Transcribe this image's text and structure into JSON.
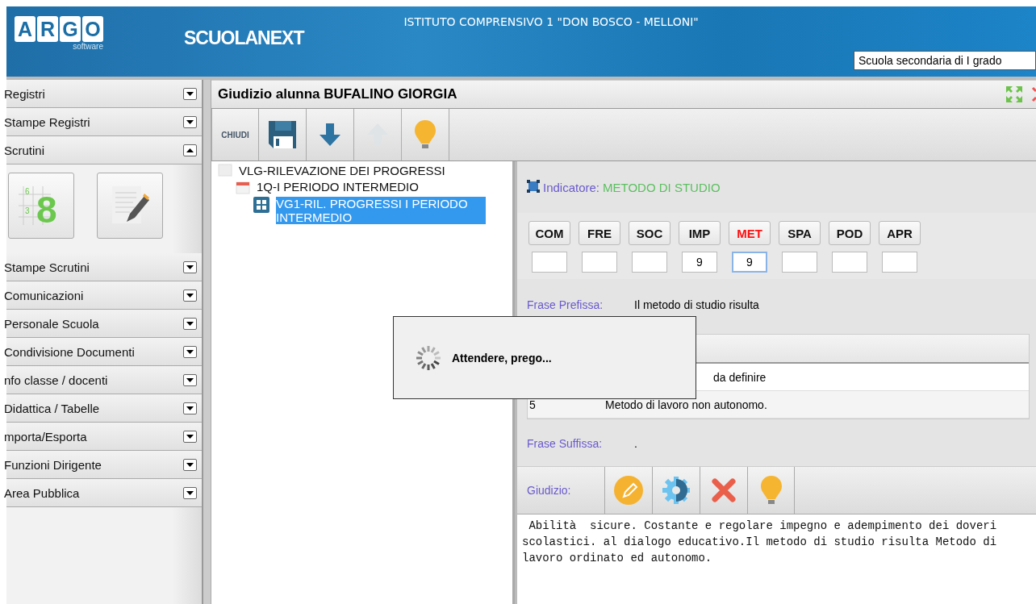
{
  "header": {
    "logo_letters": [
      "A",
      "R",
      "G",
      "O"
    ],
    "logo_sub": "software",
    "product": "SCUOLANEXT",
    "institute": "ISTITUTO COMPRENSIVO 1 \"DON BOSCO - MELLONI\"",
    "school_select": "Scuola secondaria di I grado"
  },
  "sidebar": {
    "items": [
      {
        "label": "Registri",
        "expanded": false
      },
      {
        "label": "Stampe Registri",
        "expanded": false
      },
      {
        "label": "Scrutini",
        "expanded": true
      },
      {
        "label": "Stampe Scrutini",
        "expanded": false
      },
      {
        "label": "Comunicazioni",
        "expanded": false
      },
      {
        "label": "Personale Scuola",
        "expanded": false
      },
      {
        "label": "Condivisione Documenti",
        "expanded": false
      },
      {
        "label": "nfo classe / docenti",
        "expanded": false
      },
      {
        "label": "Didattica / Tabelle",
        "expanded": false
      },
      {
        "label": "mporta/Esporta",
        "expanded": false
      },
      {
        "label": "Funzioni Dirigente",
        "expanded": false
      },
      {
        "label": "Area Pubblica",
        "expanded": false
      }
    ],
    "scrutini_icons": [
      {
        "kind": "grid",
        "labels": [
          "6",
          "3",
          "8"
        ]
      },
      {
        "kind": "pencil"
      }
    ]
  },
  "panel": {
    "title": "Giudizio alunna BUFALINO GIORGIA",
    "toolbar": [
      {
        "kind": "text",
        "label": "CHIUDI",
        "disabled": false
      },
      {
        "kind": "save",
        "disabled": false
      },
      {
        "kind": "down",
        "disabled": false
      },
      {
        "kind": "up",
        "disabled": true
      },
      {
        "kind": "bulb",
        "disabled": false
      }
    ],
    "tree": [
      {
        "label": "VLG-RILEVAZIONE DEI PROGRESSI",
        "selected": false,
        "children": [
          {
            "label": "1Q-I PERIODO INTERMEDIO",
            "selected": false,
            "children": [
              {
                "label": "VG1-RIL. PROGRESSI I PERIODO INTERMEDIO",
                "selected": true
              }
            ]
          }
        ]
      }
    ],
    "indicator": {
      "label": "Indicatore:",
      "value": "METODO DI STUDIO"
    },
    "indicators": [
      {
        "code": "COM",
        "selected": false
      },
      {
        "code": "FRE",
        "selected": false
      },
      {
        "code": "SOC",
        "selected": false
      },
      {
        "code": "IMP",
        "value": "9",
        "selected": false
      },
      {
        "code": "MET",
        "value": "9",
        "selected": true
      },
      {
        "code": "SPA",
        "selected": false
      },
      {
        "code": "POD",
        "selected": false
      },
      {
        "code": "APR",
        "selected": false
      }
    ],
    "prefix": {
      "label": "Frase Prefissa:",
      "value": "Il metodo di studio risulta"
    },
    "table": {
      "rows": [
        {
          "column_2": "da definire"
        },
        {
          "column_1": "5",
          "column_2": "Metodo di lavoro non autonomo."
        }
      ]
    },
    "suffix": {
      "label": "Frase Suffissa:",
      "value": "."
    },
    "giudizio": {
      "label": "Giudizio:",
      "tools": [
        {
          "kind": "pencil"
        },
        {
          "kind": "gear"
        },
        {
          "kind": "delete"
        },
        {
          "kind": "bulb"
        }
      ],
      "text": " Abilità  sicure. Costante e regolare impegno e adempimento dei doveri scolastici. al dialogo educativo.Il metodo di studio risulta Metodo di lavoro ordinato ed autonomo."
    }
  },
  "loading": {
    "message": "Attendere, prego..."
  }
}
